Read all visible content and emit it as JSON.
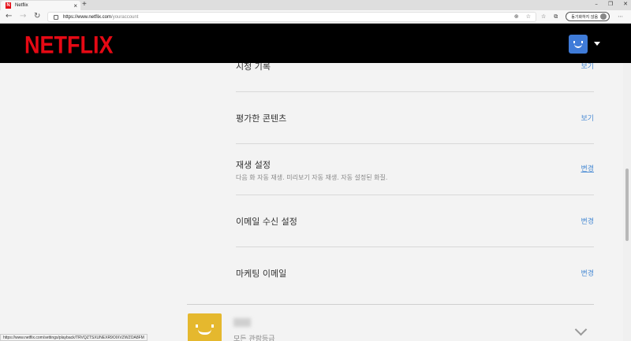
{
  "browser": {
    "tab_title": "Netflix",
    "tab_favicon": "N",
    "tab_close": "×",
    "new_tab": "+",
    "url_host": "https://www.netflix.com",
    "url_path": "/youraccount",
    "sync_label": "동기화하지 않음",
    "status_url": "https://www.netflix.com/settings/playback/TRVQZTSXUNEXR9OIXVZWZOA8FM"
  },
  "header": {
    "logo": "NETFLIX"
  },
  "settings": {
    "rows": [
      {
        "title": "시청 기록",
        "action": "보기"
      },
      {
        "title": "평가한 콘텐츠",
        "action": "보기"
      },
      {
        "title": "재생 설정",
        "subtitle": "다음 화 자동 재생. 미리보기 자동 재생. 자동 설정된 화질.",
        "action": "변경"
      },
      {
        "title": "이메일 수신 설정",
        "action": "변경"
      },
      {
        "title": "마케팅 이메일",
        "action": "변경"
      }
    ]
  },
  "profile": {
    "subtitle": "모든 관람등급"
  },
  "colors": {
    "brand": "#e50914",
    "link": "#4a8bd4",
    "avatar_blue": "#3f7bd8",
    "avatar_yellow": "#e5b82e"
  }
}
